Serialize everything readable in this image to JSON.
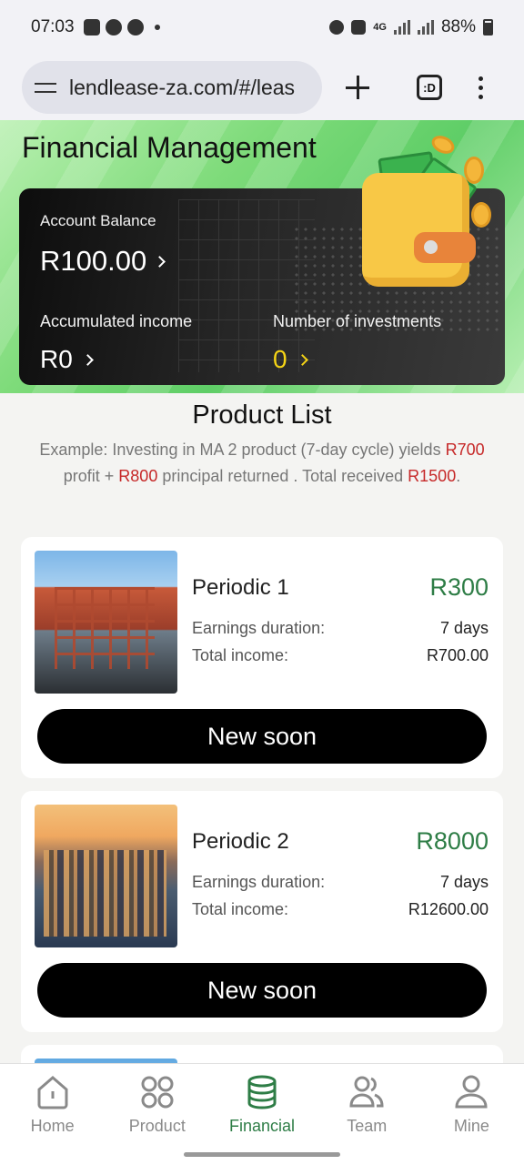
{
  "status_bar": {
    "time": "07:03",
    "network": "4G",
    "battery": "88%"
  },
  "browser": {
    "url": "lendlease-za.com/#/leas",
    "tabs_label": ":D"
  },
  "page": {
    "title": "Financial Management"
  },
  "balance_card": {
    "account_balance_label": "Account Balance",
    "account_balance_value": "R100.00",
    "accumulated_income_label": "Accumulated income",
    "accumulated_income_value": "R0",
    "investments_label": "Number of investments",
    "investments_value": "0"
  },
  "product_list": {
    "title": "Product List",
    "example": {
      "p1": "Example: Investing in MA 2 product (7-day cycle) yields ",
      "profit": "R700",
      "p2": " profit + ",
      "principal": "R800",
      "p3": " principal returned . Total received ",
      "total": "R1500",
      "p4": "."
    },
    "products": [
      {
        "name": "Periodic 1",
        "price": "R300",
        "duration_label": "Earnings duration:",
        "duration": "7 days",
        "income_label": "Total income:",
        "income": "R700.00",
        "button": "New soon"
      },
      {
        "name": "Periodic 2",
        "price": "R8000",
        "duration_label": "Earnings duration:",
        "duration": "7 days",
        "income_label": "Total income:",
        "income": "R12600.00",
        "button": "New soon"
      }
    ]
  },
  "bottom_nav": {
    "items": [
      {
        "label": "Home",
        "icon": "home-icon"
      },
      {
        "label": "Product",
        "icon": "product-grid-icon"
      },
      {
        "label": "Financial",
        "icon": "database-stack-icon"
      },
      {
        "label": "Team",
        "icon": "team-icon"
      },
      {
        "label": "Mine",
        "icon": "user-icon"
      }
    ],
    "active": "Financial"
  },
  "colors": {
    "accent": "#2e7d46",
    "highlight": "#c62828",
    "investments_value": "#f5d416"
  }
}
